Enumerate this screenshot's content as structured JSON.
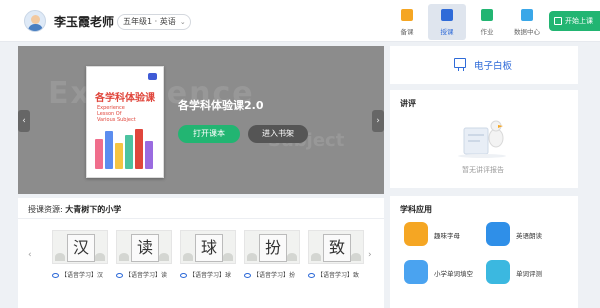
{
  "header": {
    "teacher_name": "李玉霞老师",
    "grade_select": "五年级1 · 英语",
    "nav": [
      {
        "label": "备课",
        "icon": "folder-icon",
        "color": "#f5a623",
        "active": false
      },
      {
        "label": "授课",
        "icon": "laptop-icon",
        "color": "#2f6bd8",
        "active": true
      },
      {
        "label": "作业",
        "icon": "book-icon",
        "color": "#22b572",
        "active": false
      },
      {
        "label": "数据中心",
        "icon": "monitor-icon",
        "color": "#3aa7e8",
        "active": false
      }
    ],
    "start_button": "开始上课"
  },
  "banner": {
    "course_title": "各学科体验课2.0",
    "book_cover": {
      "title": "各学科体验课",
      "subtitle": "Experience Lesson Of Various Subject"
    },
    "open_button": "打开课本",
    "shelf_button": "进入书架"
  },
  "resources": {
    "label": "授课资源:",
    "source": "大青树下的小学",
    "items": [
      {
        "char": "汉",
        "caption": "【语音学习】汉"
      },
      {
        "char": "读",
        "caption": "【语音学习】读"
      },
      {
        "char": "球",
        "caption": "【语音学习】球"
      },
      {
        "char": "扮",
        "caption": "【语音学习】扮"
      },
      {
        "char": "致",
        "caption": "【语音学习】致"
      }
    ]
  },
  "whiteboard": {
    "label": "电子白板"
  },
  "report": {
    "title": "讲评",
    "empty_text": "暂无讲评报告"
  },
  "apps": {
    "title": "学科应用",
    "items": [
      {
        "label": "趣味字母",
        "icon": "monster-app-icon",
        "color": "#f5a623"
      },
      {
        "label": "英语朗读",
        "icon": "mascot-app-icon",
        "color": "#2f8fe8"
      },
      {
        "label": "小学单词填空",
        "icon": "word-card-app-icon",
        "color": "#4aa3f0"
      },
      {
        "label": "单词评测",
        "icon": "bubble-app-icon",
        "color": "#3bb8e0"
      }
    ]
  }
}
